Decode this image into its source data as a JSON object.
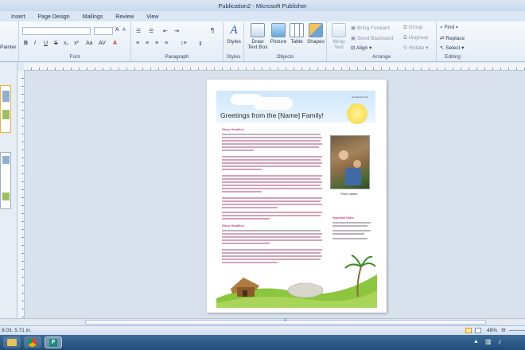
{
  "window": {
    "title": "Publication2 - Microsoft Publisher"
  },
  "tabs": [
    {
      "label": "Insert"
    },
    {
      "label": "Page Design"
    },
    {
      "label": "Mailings"
    },
    {
      "label": "Review"
    },
    {
      "label": "View"
    }
  ],
  "ribbon": {
    "clipboard": {
      "painter": "Painter"
    },
    "font": {
      "label": "Font"
    },
    "paragraph": {
      "label": "Paragraph"
    },
    "styles": {
      "label": "Styles",
      "button": "Styles"
    },
    "objects": {
      "label": "Objects",
      "draw_text_box": "Draw\nText Box",
      "picture": "Picture",
      "table": "Table",
      "shapes": "Shapes"
    },
    "arrange": {
      "label": "Arrange",
      "wrap_text": "Wrap\nText",
      "bring_forward": "Bring Forward",
      "send_backward": "Send Backward",
      "align": "Align",
      "group": "Group",
      "ungroup": "Ungroup",
      "rotate": "Rotate"
    },
    "editing": {
      "label": "Editing",
      "find": "Find",
      "replace": "Replace",
      "select": "Select"
    }
  },
  "document": {
    "heading": "Greetings from the [Name] Family!",
    "story1_title": "Story Headline",
    "story2_title": "Story Headline",
    "photo_caption": "Photo caption",
    "newsletter_date": "Newsletter Date",
    "sidebar_title": "Important Dates"
  },
  "status": {
    "position": "9.03, 5.71 in.",
    "zoom": "48%"
  },
  "colors": {
    "ribbon_bg": "#e4ecf6",
    "accent_pink": "#c2457a",
    "heading_text": "#2b2b2b",
    "taskbar": "#1f4b78"
  }
}
